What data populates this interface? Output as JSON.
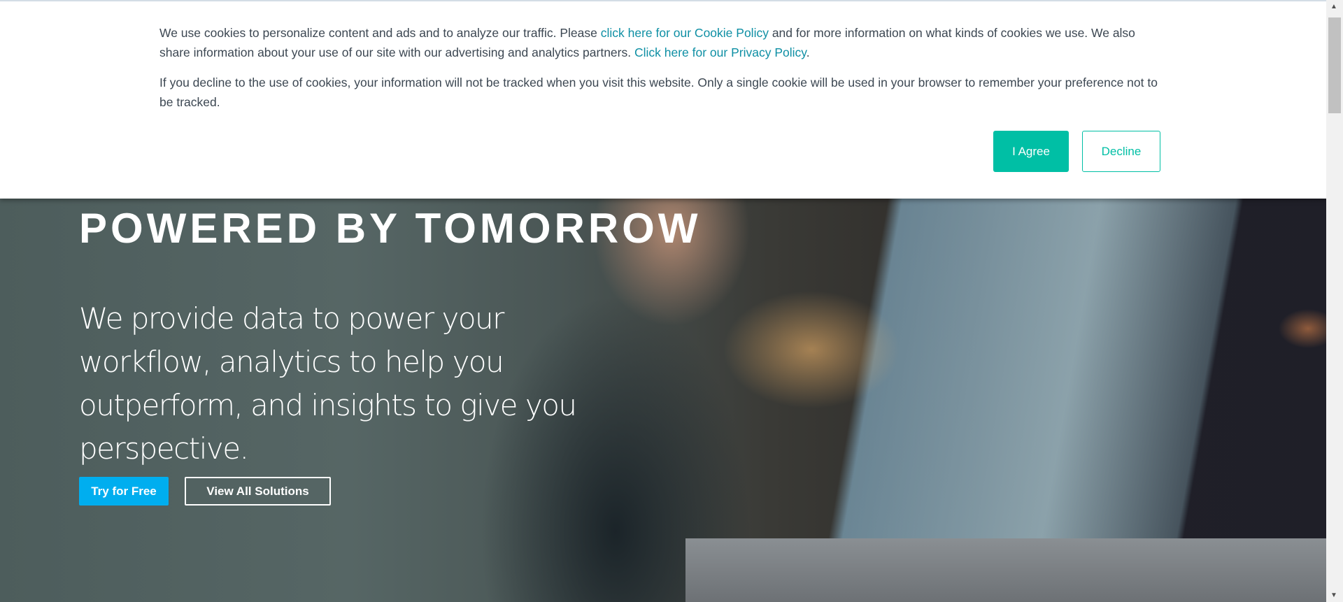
{
  "cookie_banner": {
    "p1_a": "We use cookies to personalize content and ads and to analyze our traffic. Please ",
    "cookie_link": "click here for our Cookie Policy",
    "p1_b": " and for more information on what kinds of cookies we use. We also share information about your use of our site with our advertising and analytics partners. ",
    "privacy_link": "Click here for our Privacy Policy",
    "p1_c": ".",
    "p2": "If you decline to the use of cookies, your information will not be tracked when you visit this website. Only a single cookie will be used in your browser to remember your preference not to be tracked.",
    "agree_label": "I Agree",
    "decline_label": "Decline"
  },
  "hero": {
    "title": "POWERED BY TOMORROW",
    "lead": "We provide data to power your workflow, analytics to help you outperform, and insights to give you perspective.",
    "try_label": "Try for Free",
    "view_label": "View All Solutions"
  },
  "colors": {
    "accent": "#00bfa5",
    "link": "#0e8fa4",
    "try": "#00aeef"
  }
}
